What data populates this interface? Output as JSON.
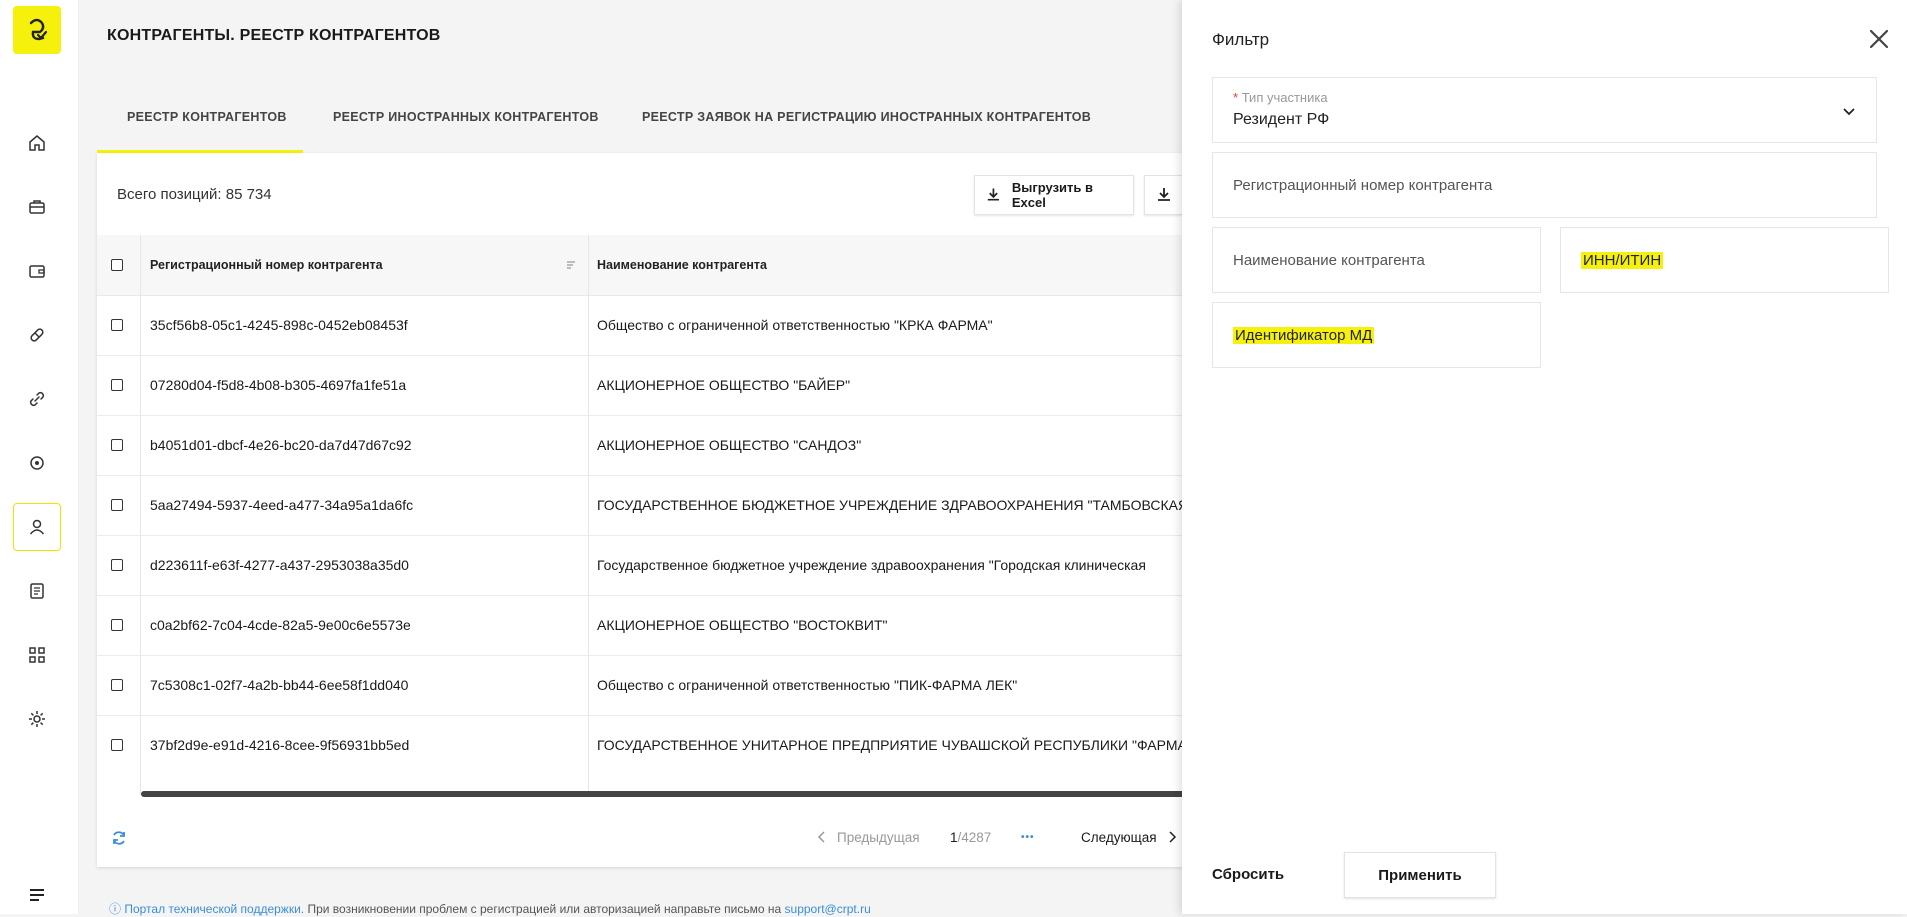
{
  "header": {
    "title": "КОНТРАГЕНТЫ. РЕЕСТР КОНТРАГЕНТОВ"
  },
  "tabs": [
    {
      "label": "РЕЕСТР КОНТРАГЕНТОВ",
      "active": true
    },
    {
      "label": "РЕЕСТР ИНОСТРАННЫХ КОНТРАГЕНТОВ",
      "active": false
    },
    {
      "label": "РЕЕСТР ЗАЯВОК НА РЕГИСТРАЦИЮ ИНОСТРАННЫХ КОНТРАГЕНТОВ",
      "active": false
    }
  ],
  "toolbar": {
    "total": "Всего позиций: 85 734",
    "export_excel": "Выгрузить в Excel"
  },
  "table": {
    "columns": [
      "Регистрационный номер контрагента",
      "Наименование контрагента"
    ],
    "rows": [
      {
        "reg": "35cf56b8-05c1-4245-898c-0452eb08453f",
        "name": "Общество с ограниченной ответственностью \"КРКА ФАРМА\""
      },
      {
        "reg": "07280d04-f5d8-4b08-b305-4697fa1fe51a",
        "name": "АКЦИОНЕРНОЕ ОБЩЕСТВО \"БАЙЕР\""
      },
      {
        "reg": "b4051d01-dbcf-4e26-bc20-da7d47d67c92",
        "name": "АКЦИОНЕРНОЕ ОБЩЕСТВО \"САНДОЗ\""
      },
      {
        "reg": "5aa27494-5937-4eed-a477-34a95a1da6fc",
        "name": "ГОСУДАРСТВЕННОЕ БЮДЖЕТНОЕ УЧРЕЖДЕНИЕ ЗДРАВООХРАНЕНИЯ \"ТАМБОВСКАЯ"
      },
      {
        "reg": "d223611f-e63f-4277-a437-2953038a35d0",
        "name": "Государственное бюджетное учреждение здравоохранения \"Городская клиническая"
      },
      {
        "reg": "c0a2bf62-7c04-4cde-82a5-9e00c6e5573e",
        "name": "АКЦИОНЕРНОЕ ОБЩЕСТВО \"ВОСТОКВИТ\""
      },
      {
        "reg": "7c5308c1-02f7-4a2b-bb44-6ee58f1dd040",
        "name": "Общество с ограниченной ответственностью \"ПИК-ФАРМА ЛЕК\""
      },
      {
        "reg": "37bf2d9e-e91d-4216-8cee-9f56931bb5ed",
        "name": "ГОСУДАРСТВЕННОЕ УНИТАРНОЕ ПРЕДПРИЯТИЕ ЧУВАШСКОЙ РЕСПУБЛИКИ \"ФАРМАЦИЯ\""
      }
    ]
  },
  "pagination": {
    "prev": "Предыдущая",
    "current": "1",
    "total": "/4287",
    "more": "•••",
    "next": "Следующая"
  },
  "filter": {
    "title": "Фильтр",
    "participant_type_label": "Тип участника",
    "participant_type_required": "*",
    "participant_type_value": "Резидент РФ",
    "reg_number_placeholder": "Регистрационный номер контрагента",
    "name_placeholder": "Наименование контрагента",
    "inn_placeholder": "ИНН/ИТИН",
    "md_id_placeholder": "Идентификатор МД",
    "reset": "Сбросить",
    "apply": "Применить"
  },
  "footer": {
    "support_link": "Портал технической поддержки.",
    "text": " При возникновении проблем с регистрацией или авторизацией направьте письмо на ",
    "email": "support@crpt.ru"
  },
  "icons": [
    "logo-icon",
    "home-icon",
    "briefcase-icon",
    "wallet-icon",
    "pill-icon",
    "link-icon",
    "eye-icon",
    "user-icon",
    "document-icon",
    "qr-icon",
    "settings-icon",
    "menu-icon",
    "download-icon",
    "sort-icon",
    "refresh-icon",
    "chevron-left-icon",
    "chevron-right-icon",
    "chevron-down-icon",
    "close-icon",
    "help-icon"
  ],
  "colors": {
    "accent": "#f5f10c",
    "link": "#3b8ed8"
  }
}
